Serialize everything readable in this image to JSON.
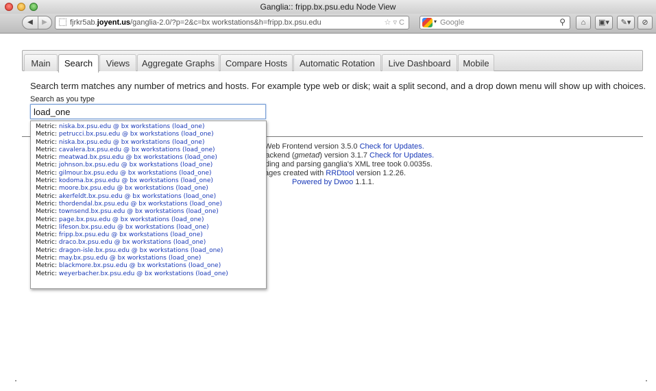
{
  "window": {
    "title": "Ganglia:: fripp.bx.psu.edu Node View"
  },
  "toolbar": {
    "back_icon": "◀",
    "forward_icon": "▶",
    "url_prefix": "fjrkr5ab.",
    "url_host": "joyent.us",
    "url_rest": "/ganglia-2.0/?p=2&c=bx workstations&h=fripp.bx.psu.edu",
    "url_icons": "☆ ▿ C",
    "search_engine": "Google",
    "search_icon": "⚲",
    "home_icon": "⌂",
    "bookmarks_icon": "▣▾",
    "addon_icon": "✎▾",
    "tool_icon": "⊘"
  },
  "tabs": [
    {
      "label": "Main",
      "active": false
    },
    {
      "label": "Search",
      "active": true
    },
    {
      "label": "Views",
      "active": false
    },
    {
      "label": "Aggregate Graphs",
      "active": false
    },
    {
      "label": "Compare Hosts",
      "active": false
    },
    {
      "label": "Automatic Rotation",
      "active": false
    },
    {
      "label": "Live Dashboard",
      "active": false
    },
    {
      "label": "Mobile",
      "active": false
    }
  ],
  "search": {
    "help_text": "Search term matches any number of metrics and hosts. For example type web or disk; wait a split second, and a drop down menu will show up with choices.",
    "label": "Search as you type",
    "value": "load_one"
  },
  "dropdown": {
    "prefix": "Metric:",
    "items": [
      "niska.bx.psu.edu @ bx workstations (load_one)",
      "petrucci.bx.psu.edu @ bx workstations (load_one)",
      "niska.bx.psu.edu @ bx workstations (load_one)",
      "cavalera.bx.psu.edu @ bx workstations (load_one)",
      "meatwad.bx.psu.edu @ bx workstations (load_one)",
      "johnson.bx.psu.edu @ bx workstations (load_one)",
      "gilmour.bx.psu.edu @ bx workstations (load_one)",
      "kodoma.bx.psu.edu @ bx workstations (load_one)",
      "moore.bx.psu.edu @ bx workstations (load_one)",
      "akerfeldt.bx.psu.edu @ bx workstations (load_one)",
      "thordendal.bx.psu.edu @ bx workstations (load_one)",
      "townsend.bx.psu.edu @ bx workstations (load_one)",
      "page.bx.psu.edu @ bx workstations (load_one)",
      "lifeson.bx.psu.edu @ bx workstations (load_one)",
      "fripp.bx.psu.edu @ bx workstations (load_one)",
      "draco.bx.psu.edu @ bx workstations (load_one)",
      "dragon-isle.bx.psu.edu @ bx workstations (load_one)",
      "may.bx.psu.edu @ bx workstations (load_one)",
      "blackmore.bx.psu.edu @ bx workstations (load_one)",
      "weyerbacher.bx.psu.edu @ bx workstations (load_one)"
    ]
  },
  "footer": {
    "line1_text": "Web Frontend version 3.5.0 ",
    "line1_link": "Check for Updates.",
    "line2_a": " Backend (",
    "line2_italic": "gmetad",
    "line2_b": ") version 3.1.7 ",
    "line2_link": "Check for Updates.",
    "line3": "ding and parsing ganglia's XML tree took 0.0035s.",
    "line4_a": "ages created with ",
    "line4_link": "RRDtool",
    "line4_b": " version 1.2.26.",
    "line5_link": "Powered by Dwoo",
    "line5_b": " 1.1.1."
  }
}
